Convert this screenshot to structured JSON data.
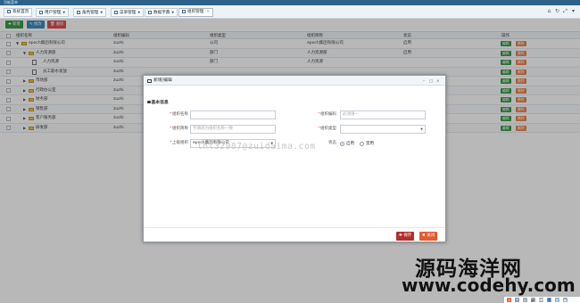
{
  "titlebar": {
    "text": "功能菜单"
  },
  "tabs": [
    {
      "label": "系统首页",
      "has_dropdown": false,
      "closable": false
    },
    {
      "label": "用户管理",
      "has_dropdown": true,
      "closable": false
    },
    {
      "label": "角色管理",
      "has_dropdown": true,
      "closable": false
    },
    {
      "label": "菜单管理",
      "has_dropdown": true,
      "closable": false
    },
    {
      "label": "数据字典",
      "has_dropdown": true,
      "closable": false
    },
    {
      "label": "组织管理",
      "has_dropdown": false,
      "closable": true,
      "active": true
    }
  ],
  "toolbar": {
    "add_label": "新增",
    "edit_label": "修改",
    "delete_label": "删除"
  },
  "grid": {
    "headers": [
      "组织名称",
      "组织编码",
      "组织类型",
      "组织简称",
      "状态",
      "操作"
    ],
    "rows": [
      {
        "name": "epoch集团有限公司",
        "code": "zuzhi",
        "type": "公司",
        "short": "epoch集团有限公司",
        "status": "启用",
        "level": 0,
        "icon": "folder",
        "expanded": true
      },
      {
        "name": "人力资源部",
        "code": "zuzhi",
        "type": "部门",
        "short": "人力资源部",
        "status": "启用",
        "level": 1,
        "icon": "folder",
        "expanded": true
      },
      {
        "name": "人力资源",
        "code": "zuzhi",
        "type": "部门",
        "short": "人力资源",
        "status": "",
        "level": 2,
        "icon": "doc",
        "expanded": false
      },
      {
        "name": "员工薪水发放",
        "code": "zuzhi",
        "type": "",
        "short": "",
        "status": "",
        "level": 2,
        "icon": "doc",
        "expanded": false
      },
      {
        "name": "市场部",
        "code": "zuzhi",
        "type": "",
        "short": "",
        "status": "",
        "level": 1,
        "icon": "folder",
        "expanded": false
      },
      {
        "name": "行政办公室",
        "code": "zuzhi",
        "type": "",
        "short": "",
        "status": "",
        "level": 1,
        "icon": "folder",
        "expanded": false
      },
      {
        "name": "财务部",
        "code": "zuzhi",
        "type": "",
        "short": "",
        "status": "",
        "level": 1,
        "icon": "folder",
        "expanded": false
      },
      {
        "name": "销售部",
        "code": "zuzhi",
        "type": "",
        "short": "",
        "status": "",
        "level": 1,
        "icon": "folder",
        "expanded": false
      },
      {
        "name": "客户服务部",
        "code": "zuzhi",
        "type": "",
        "short": "",
        "status": "",
        "level": 1,
        "icon": "folder",
        "expanded": false
      },
      {
        "name": "研发部",
        "code": "zuzhi",
        "type": "",
        "short": "",
        "status": "",
        "level": 1,
        "icon": "folder",
        "expanded": false
      }
    ],
    "row_edit_label": "编辑",
    "row_delete_label": "删除"
  },
  "modal": {
    "title": "新增/编辑",
    "section_title": "基本信息",
    "fields": {
      "org_name_label": "组织名称",
      "org_name_value": "",
      "org_code_label": "组织编码",
      "org_code_placeholder": "必须填一",
      "org_short_label": "组织简称",
      "org_short_placeholder": "不填则为组织名称一致",
      "org_type_label": "组织类型",
      "org_type_value": "",
      "parent_label": "上级组织",
      "parent_value": "epoch集团有限公司",
      "status_label": "状态",
      "status_options": [
        "启用",
        "禁用"
      ],
      "status_selected": "启用"
    },
    "save_label": "保存",
    "close_label": "关闭"
  },
  "watermark": "lhl32987@zuidaima.com",
  "branding": {
    "name": "源码海洋网",
    "url": "www.codehy.com"
  },
  "colors": {
    "titlebar": "#2d6189",
    "add": "#3a9b4c",
    "edit": "#3c8dbc",
    "delete": "#d9534f",
    "save": "#b22f2a",
    "close": "#e35a2e"
  }
}
